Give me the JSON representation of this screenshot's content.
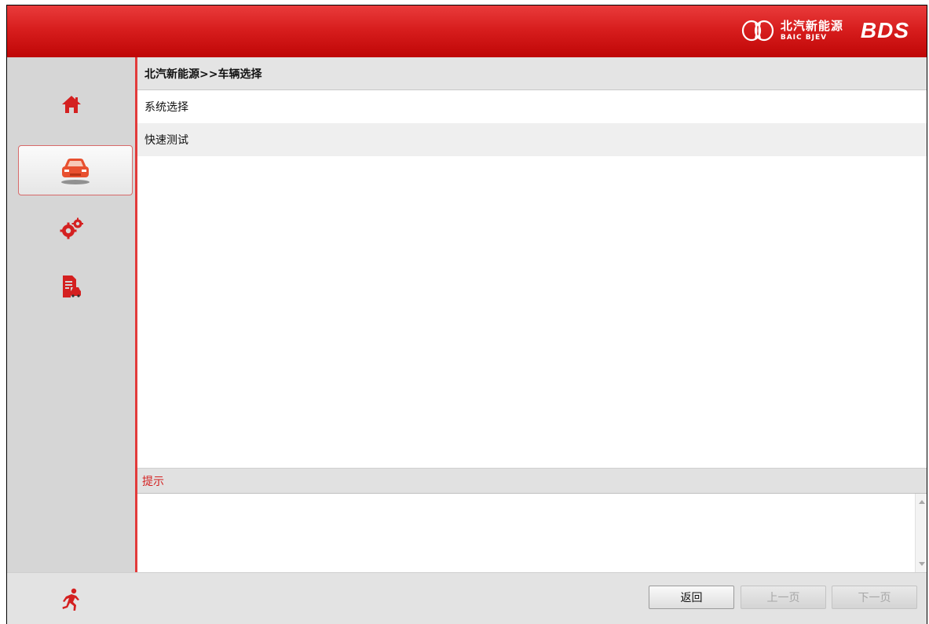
{
  "header": {
    "brand_cn": "北汽新能源",
    "brand_en": "BAIC BJEV",
    "brand_product": "BDS"
  },
  "sidebar": {
    "items": [
      {
        "icon": "home-icon",
        "active": false
      },
      {
        "icon": "car-icon",
        "active": true
      },
      {
        "icon": "gears-icon",
        "active": false
      },
      {
        "icon": "report-icon",
        "active": false
      }
    ]
  },
  "main": {
    "breadcrumb": "北汽新能源>>车辆选择",
    "list": [
      {
        "label": "系统选择"
      },
      {
        "label": "快速测试"
      }
    ],
    "hint_title": "提示",
    "hint_text": ""
  },
  "footer": {
    "back_label": "返回",
    "prev_label": "上一页",
    "next_label": "下一页",
    "prev_enabled": false,
    "next_enabled": false
  },
  "colors": {
    "accent": "#d81e1e",
    "header_top": "#e93b3b",
    "header_bottom": "#bf0606",
    "hint_text": "#d42020",
    "sidebar_bg": "#d6d6d6"
  }
}
